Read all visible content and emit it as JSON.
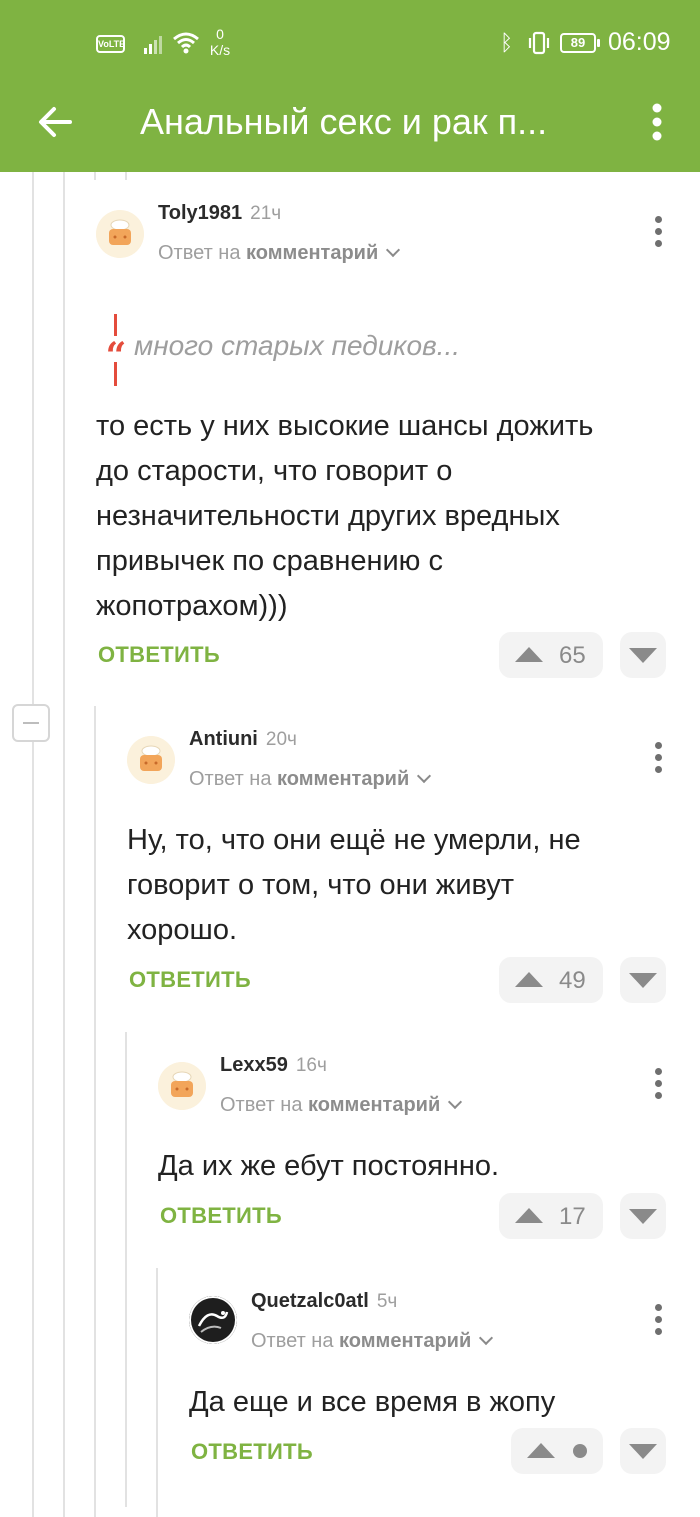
{
  "status_bar": {
    "volte": "VoLTE",
    "speed_value": "0",
    "speed_unit": "K/s",
    "battery": "89",
    "time": "06:09"
  },
  "app_bar": {
    "title": "Анальный секс и рак п...",
    "back_icon": "arrow-left-icon",
    "menu_icon": "more-vert-icon"
  },
  "labels": {
    "reply_to": "Ответ на",
    "reply_to_target": "комментарий",
    "reply_button": "ОТВЕТИТЬ"
  },
  "comments": [
    {
      "author": "Toly1981",
      "time": "21ч",
      "quote": "много старых педиков...",
      "text": "то есть у них высокие шансы дожить до старости, что говорит о незначительности других вредных привычек по сравнению с жопотрахом)))",
      "rating": "65"
    },
    {
      "author": "Antiuni",
      "time": "20ч",
      "text": "Ну, то, что они ещё не умерли, не говорит о том, что они живут хорошо.",
      "rating": "49"
    },
    {
      "author": "Lexx59",
      "time": "16ч",
      "text": "Да их же ебут постоянно.",
      "rating": "17"
    },
    {
      "author": "Quetzalc0atl",
      "time": "5ч",
      "text": "Да еще и все время в жопу",
      "rating": ""
    }
  ],
  "colors": {
    "accent": "#7fb342",
    "quote_accent": "#e44c3c",
    "muted": "#9e9e9e"
  }
}
